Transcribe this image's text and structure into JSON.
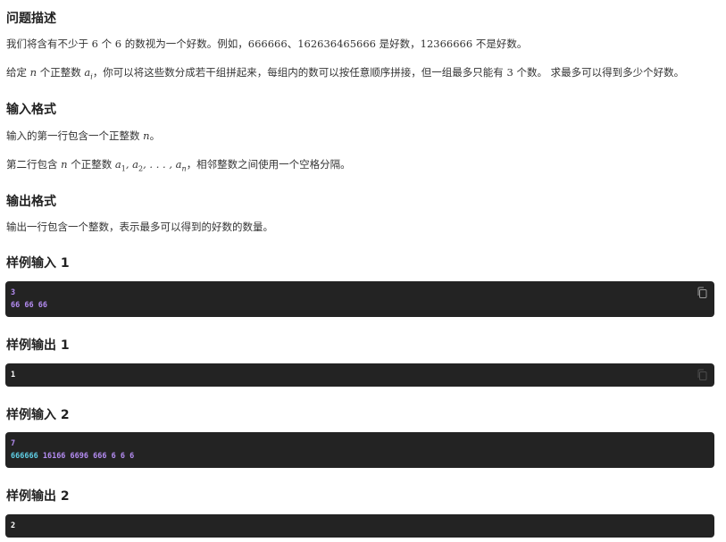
{
  "sections": {
    "desc_title": "问题描述",
    "desc_p1": {
      "a": "我们将含有不少于 ",
      "six": "6",
      "b": " 个 ",
      "six2": "6",
      "c": " 的数视为一个好数。例如，",
      "ex1": "666666",
      "sep": "、",
      "ex2": "162636465666",
      "d": " 是好数，",
      "ex3": "12366666",
      "e": " 不是好数。"
    },
    "desc_p2": {
      "a": "给定 ",
      "n": "n",
      "b": " 个正整数 ",
      "ai": "a",
      "ai_sub": "i",
      "c": "，你可以将这些数分成若干组拼起来，每组内的数可以按任意顺序拼接，但一组最多只能有 ",
      "three": "3",
      "d": " 个数。 求最多可以得到多少个好数。"
    },
    "input_title": "输入格式",
    "input_p1": {
      "a": "输入的第一行包含一个正整数 ",
      "n": "n",
      "b": "。"
    },
    "input_p2": {
      "a": "第二行包含 ",
      "n": "n",
      "b": " 个正整数 ",
      "seq": "a",
      "s1": "1",
      "comma1": ", a",
      "s2": "2",
      "dots": ", . . . , a",
      "sn": "n",
      "c": "，相邻整数之间使用一个空格分隔。"
    },
    "output_title": "输出格式",
    "output_p1": "输出一行包含一个整数，表示最多可以得到的好数的数量。",
    "sample_in1_title": "样例输入 1",
    "sample_in1": {
      "line1": "3",
      "line2": "66 66 66"
    },
    "sample_out1_title": "样例输出 1",
    "sample_out1": {
      "line1": "1"
    },
    "sample_in2_title": "样例输入 2",
    "sample_in2": {
      "line1": "7",
      "line2_a": "666666",
      "line2_b": " 16166 6696 666 6 6 6"
    },
    "sample_out2_title": "样例输出 2",
    "sample_out2": {
      "line1": "2"
    }
  },
  "colors": {
    "code_bg": "#232323",
    "code_purple": "#b48cf2",
    "code_cyan": "#5fcfe6"
  },
  "icons": {
    "copy": "copy-icon"
  }
}
